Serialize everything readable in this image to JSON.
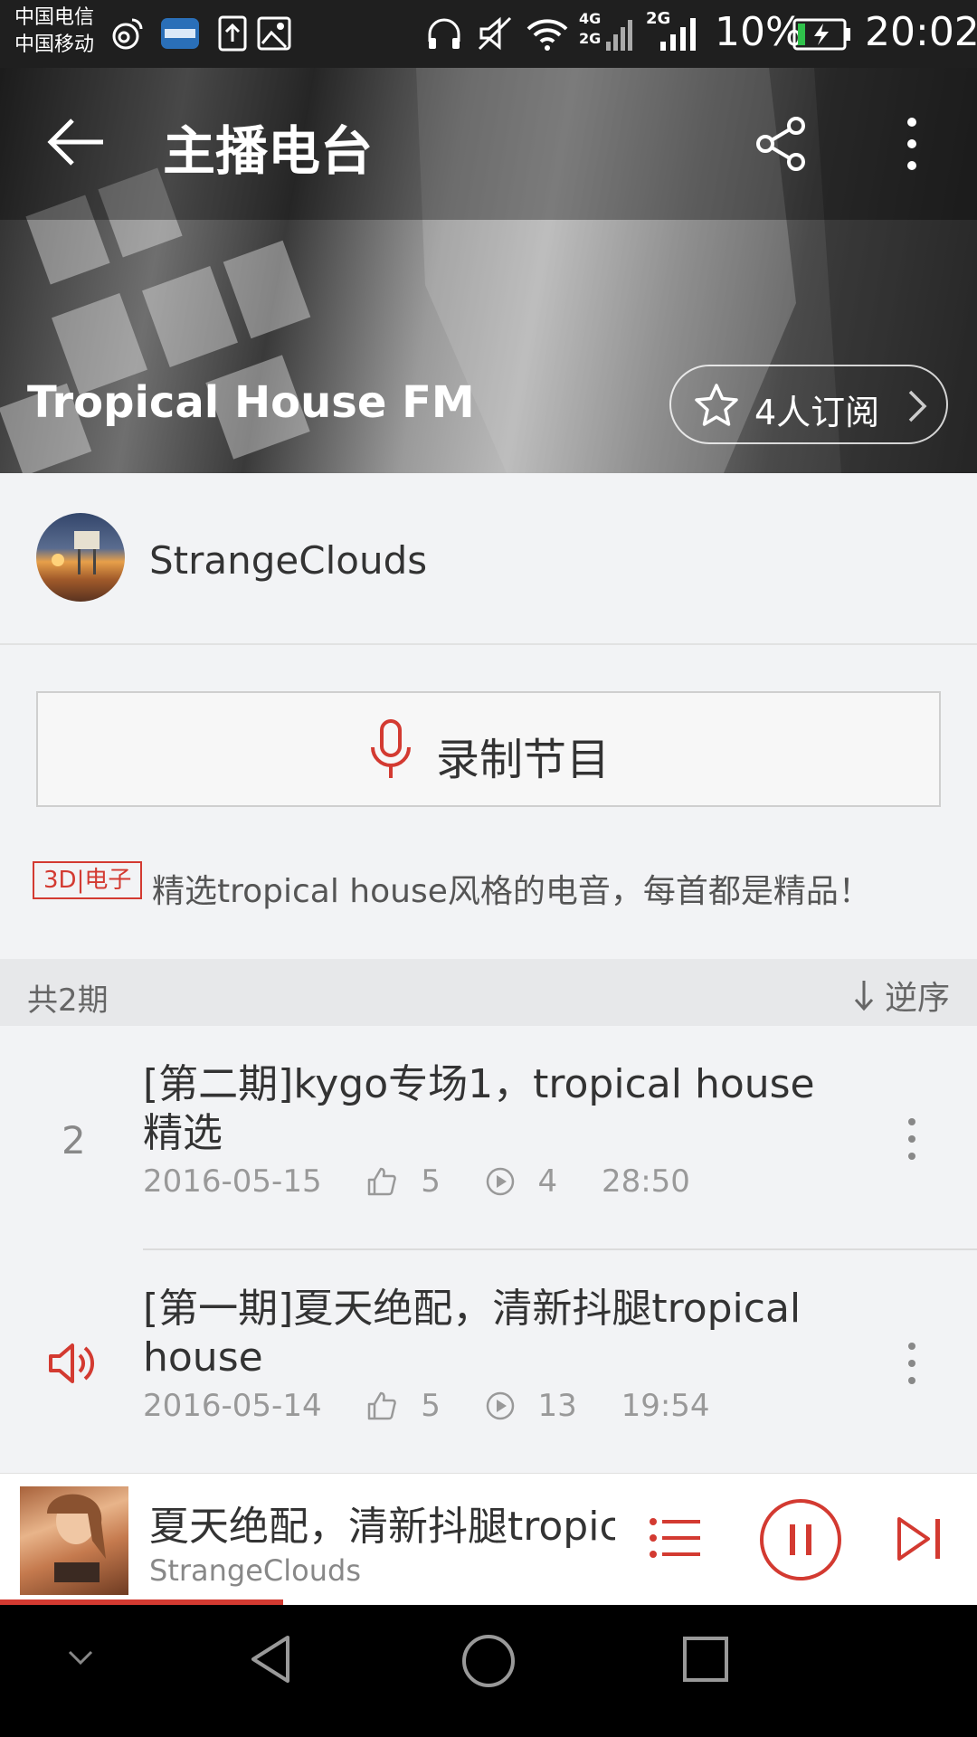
{
  "status_bar": {
    "carrier_1": "中国电信",
    "carrier_2": "中国移动",
    "network_1": "4G",
    "network_2": "2G",
    "network_3": "2G",
    "battery": "10%",
    "time": "20:02",
    "icons": [
      "weibo-icon",
      "app-icon",
      "upload-icon",
      "image-icon",
      "headphones-icon",
      "mute-icon",
      "wifi-icon",
      "signal-icon",
      "battery-icon"
    ]
  },
  "header": {
    "title": "主播电台",
    "station_name": "Tropical House FM",
    "subscribe_label": "4人订阅"
  },
  "host": {
    "name": "StrangeClouds"
  },
  "record": {
    "label": "录制节目"
  },
  "description": {
    "tag": "3D|电子",
    "text": "精选tropical house风格的电音，每首都是精品！"
  },
  "list_header": {
    "count": "共2期",
    "sort_label": "逆序"
  },
  "episodes": [
    {
      "index": "2",
      "title": "[第二期]kygo专场1，tropical house精选",
      "date": "2016-05-15",
      "likes": "5",
      "plays": "4",
      "duration": "28:50",
      "playing": false
    },
    {
      "index": "",
      "title": "[第一期]夏天绝配，清新抖腿tropical house",
      "date": "2016-05-14",
      "likes": "5",
      "plays": "13",
      "duration": "19:54",
      "playing": true
    }
  ],
  "now_playing": {
    "title": "夏天绝配，清新抖腿tropic",
    "artist": "StrangeClouds",
    "progress": 0.29
  },
  "colors": {
    "accent": "#d33a31",
    "status_bar": "#1f1f1f",
    "background": "#f2f3f5"
  }
}
